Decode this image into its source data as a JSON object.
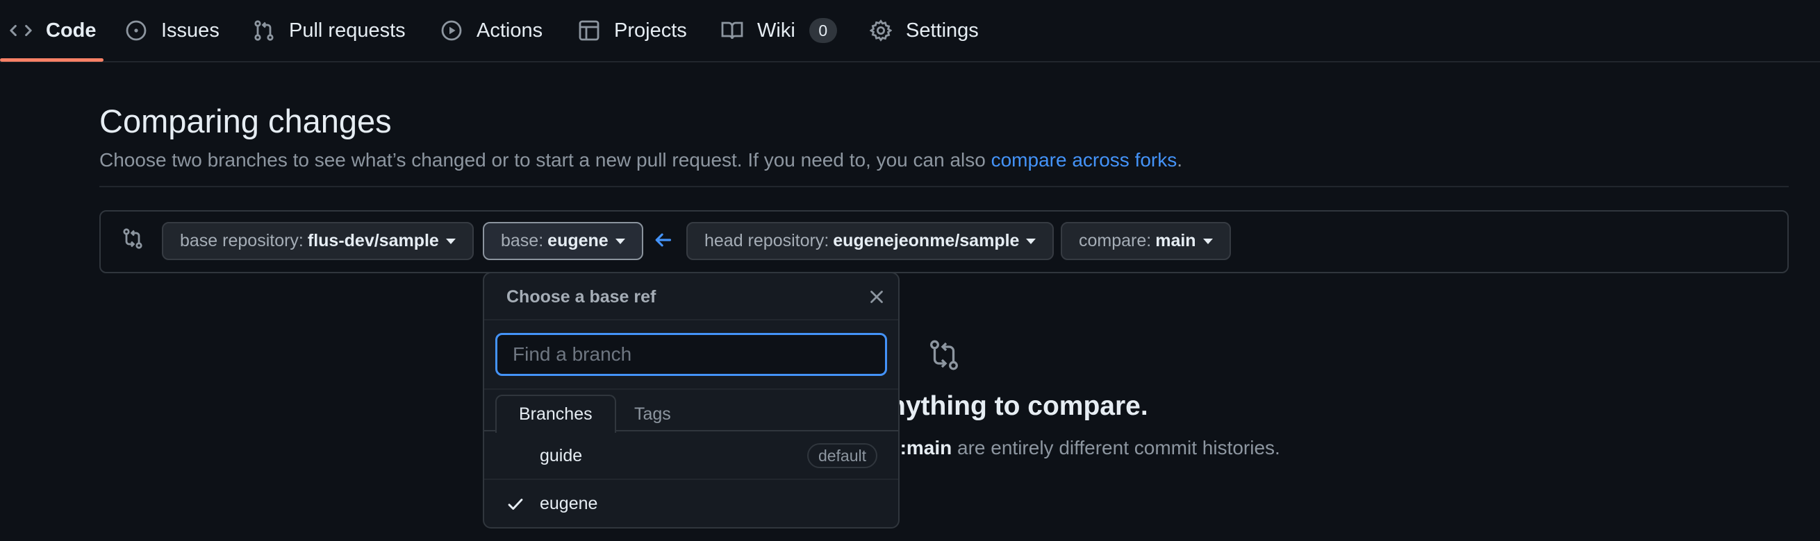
{
  "nav": {
    "tabs": [
      {
        "label": "Code",
        "icon": "code-icon",
        "selected": true
      },
      {
        "label": "Issues",
        "icon": "issue-opened-icon"
      },
      {
        "label": "Pull requests",
        "icon": "git-pull-request-icon"
      },
      {
        "label": "Actions",
        "icon": "play-icon"
      },
      {
        "label": "Projects",
        "icon": "table-icon"
      },
      {
        "label": "Wiki",
        "icon": "book-icon",
        "counter": "0"
      },
      {
        "label": "Settings",
        "icon": "gear-icon"
      }
    ]
  },
  "header": {
    "title": "Comparing changes",
    "description": "Choose two branches to see what’s changed or to start a new pull request. If you need to, you can also ",
    "link": "compare across forks",
    "description_end": "."
  },
  "range": {
    "base_repo_label": "base repository:",
    "base_repo_value": "flus-dev/sample",
    "base_label": "base:",
    "base_value": "eugene",
    "head_repo_label": "head repository:",
    "head_repo_value": "eugenejeonme/sample",
    "compare_label": "compare:",
    "compare_value": "main"
  },
  "blankslate": {
    "title_visible": "nything to compare.",
    "desc_bold": "e:main",
    "desc_rest": " are entirely different commit histories."
  },
  "dropdown": {
    "title": "Choose a base ref",
    "placeholder": "Find a branch",
    "tabs": [
      "Branches",
      "Tags"
    ],
    "branches": [
      {
        "name": "guide",
        "badge": "default",
        "selected": false
      },
      {
        "name": "eugene",
        "selected": true
      }
    ]
  },
  "colors": {
    "background": "#0d1117",
    "accent_link": "#4493f8",
    "nav_underline": "#f78166"
  }
}
